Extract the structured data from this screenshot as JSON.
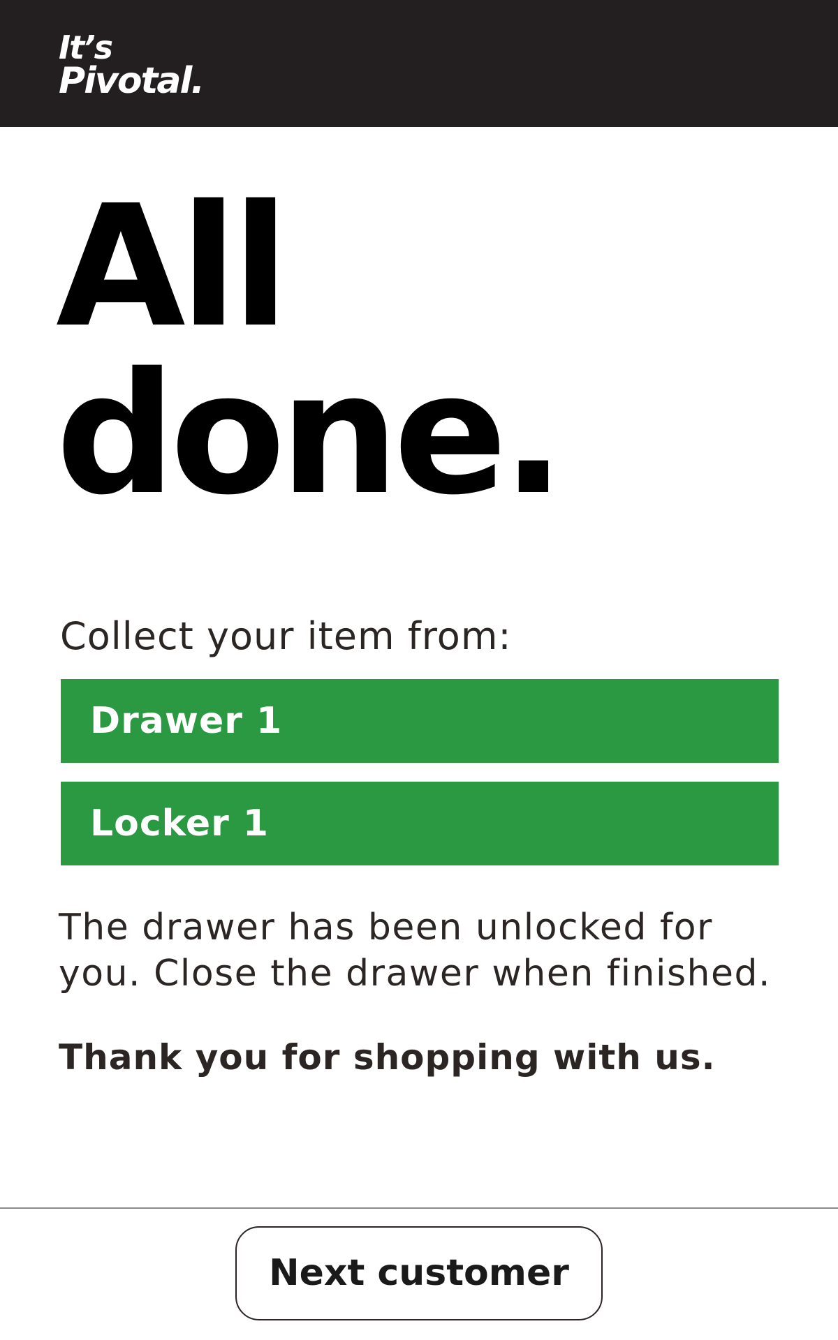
{
  "header": {
    "logo_line1": "It’s",
    "logo_line2": "Pivotal.",
    "background_color": "#231f20"
  },
  "main": {
    "headline_line1": "All",
    "headline_line2": "done.",
    "collect_label": "Collect your item from:",
    "locations": [
      {
        "label": "Drawer 1"
      },
      {
        "label": "Locker 1"
      }
    ],
    "location_color": "#2a9942",
    "message": "The drawer has been unlocked for you. Close the drawer when finished.",
    "thanks": "Thank you for shopping with us."
  },
  "footer": {
    "next_button_label": "Next customer"
  }
}
